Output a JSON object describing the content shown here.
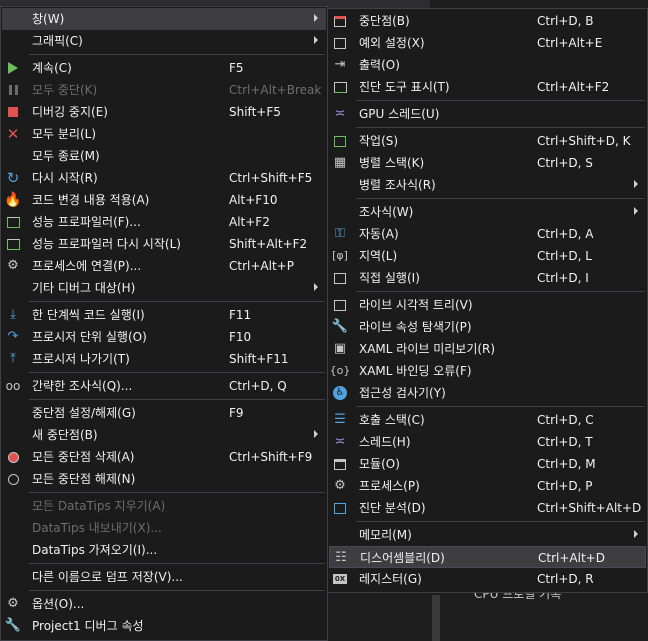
{
  "colors": {
    "menu_bg": "#1b1b1c",
    "highlight": "#3e3e40",
    "border": "#3f3f46",
    "text": "#f1f1f1",
    "disabled": "#6d6d6d",
    "play_green": "#6cbf5a",
    "stop_red": "#e05252",
    "blue_icon": "#4fa3e0"
  },
  "debug_menu": {
    "window": {
      "label": "창(W)"
    },
    "graphics": {
      "label": "그래픽(C)"
    },
    "continue": {
      "label": "계속(C)",
      "shortcut": "F5"
    },
    "break_all": {
      "label": "모두 중단(K)",
      "shortcut": "Ctrl+Alt+Break"
    },
    "stop": {
      "label": "디버깅 중지(E)",
      "shortcut": "Shift+F5"
    },
    "detach_all": {
      "label": "모두 분리(L)"
    },
    "terminate_all": {
      "label": "모두 종료(M)"
    },
    "restart": {
      "label": "다시 시작(R)",
      "shortcut": "Ctrl+Shift+F5"
    },
    "apply_code_changes": {
      "label": "코드 변경 내용 적용(A)",
      "shortcut": "Alt+F10"
    },
    "profiler": {
      "label": "성능 프로파일러(F)...",
      "shortcut": "Alt+F2"
    },
    "relaunch_profiler": {
      "label": "성능 프로파일러 다시 시작(L)",
      "shortcut": "Shift+Alt+F2"
    },
    "attach": {
      "label": "프로세스에 연결(P)...",
      "shortcut": "Ctrl+Alt+P"
    },
    "other_targets": {
      "label": "기타 디버그 대상(H)"
    },
    "step_into": {
      "label": "한 단계씩 코드 실행(I)",
      "shortcut": "F11"
    },
    "step_over": {
      "label": "프로시저 단위 실행(O)",
      "shortcut": "F10"
    },
    "step_out": {
      "label": "프로시저 나가기(T)",
      "shortcut": "Shift+F11"
    },
    "quick_watch": {
      "label": "간략한 조사식(Q)...",
      "shortcut": "Ctrl+D, Q"
    },
    "toggle_breakpoint": {
      "label": "중단점 설정/해제(G)",
      "shortcut": "F9"
    },
    "new_breakpoint": {
      "label": "새 중단점(B)"
    },
    "delete_breakpoints": {
      "label": "모든 중단점 삭제(A)",
      "shortcut": "Ctrl+Shift+F9"
    },
    "disable_breakpoints": {
      "label": "모든 중단점 해제(N)"
    },
    "clear_datatips": {
      "label": "모든 DataTips 지우기(A)"
    },
    "export_datatips": {
      "label": "DataTips 내보내기(X)..."
    },
    "import_datatips": {
      "label": "DataTips 가져오기(I)..."
    },
    "save_dump": {
      "label": "다른 이름으로 덤프 저장(V)..."
    },
    "options": {
      "label": "옵션(O)..."
    },
    "project_props": {
      "label": "Project1 디버그 속성"
    }
  },
  "window_menu": {
    "breakpoints": {
      "label": "중단점(B)",
      "shortcut": "Ctrl+D, B"
    },
    "exception_settings": {
      "label": "예외 설정(X)",
      "shortcut": "Ctrl+Alt+E"
    },
    "output": {
      "label": "출력(O)"
    },
    "diag_tools": {
      "label": "진단 도구 표시(T)",
      "shortcut": "Ctrl+Alt+F2"
    },
    "gpu_threads": {
      "label": "GPU 스레드(U)"
    },
    "tasks": {
      "label": "작업(S)",
      "shortcut": "Ctrl+Shift+D, K"
    },
    "parallel_stacks": {
      "label": "병렬 스택(K)",
      "shortcut": "Ctrl+D, S"
    },
    "parallel_watch": {
      "label": "병렬 조사식(R)"
    },
    "watch": {
      "label": "조사식(W)"
    },
    "autos": {
      "label": "자동(A)",
      "shortcut": "Ctrl+D, A"
    },
    "locals": {
      "label": "지역(L)",
      "shortcut": "Ctrl+D, L"
    },
    "immediate": {
      "label": "직접 실행(I)",
      "shortcut": "Ctrl+D, I"
    },
    "live_visual_tree": {
      "label": "라이브 시각적 트리(V)"
    },
    "live_property_explorer": {
      "label": "라이브 속성 탐색기(P)"
    },
    "xaml_live_preview": {
      "label": "XAML 라이브 미리보기(R)"
    },
    "xaml_binding_failures": {
      "label": "XAML 바인딩 오류(F)"
    },
    "accessibility_checker": {
      "label": "접근성 검사기(Y)"
    },
    "call_stack": {
      "label": "호출 스택(C)",
      "shortcut": "Ctrl+D, C"
    },
    "threads": {
      "label": "스레드(H)",
      "shortcut": "Ctrl+D, T"
    },
    "modules": {
      "label": "모듈(O)",
      "shortcut": "Ctrl+D, M"
    },
    "processes": {
      "label": "프로세스(P)",
      "shortcut": "Ctrl+D, P"
    },
    "diagnostic_analysis": {
      "label": "진단 분석(D)",
      "shortcut": "Ctrl+Shift+Alt+D"
    },
    "memory": {
      "label": "메모리(M)"
    },
    "disassembly": {
      "label": "디스어셈블리(D)",
      "shortcut": "Ctrl+Alt+D"
    },
    "registers": {
      "label": "레지스터(G)",
      "shortcut": "Ctrl+D, R"
    }
  },
  "background": {
    "text": "CPU 프로필 기록"
  }
}
